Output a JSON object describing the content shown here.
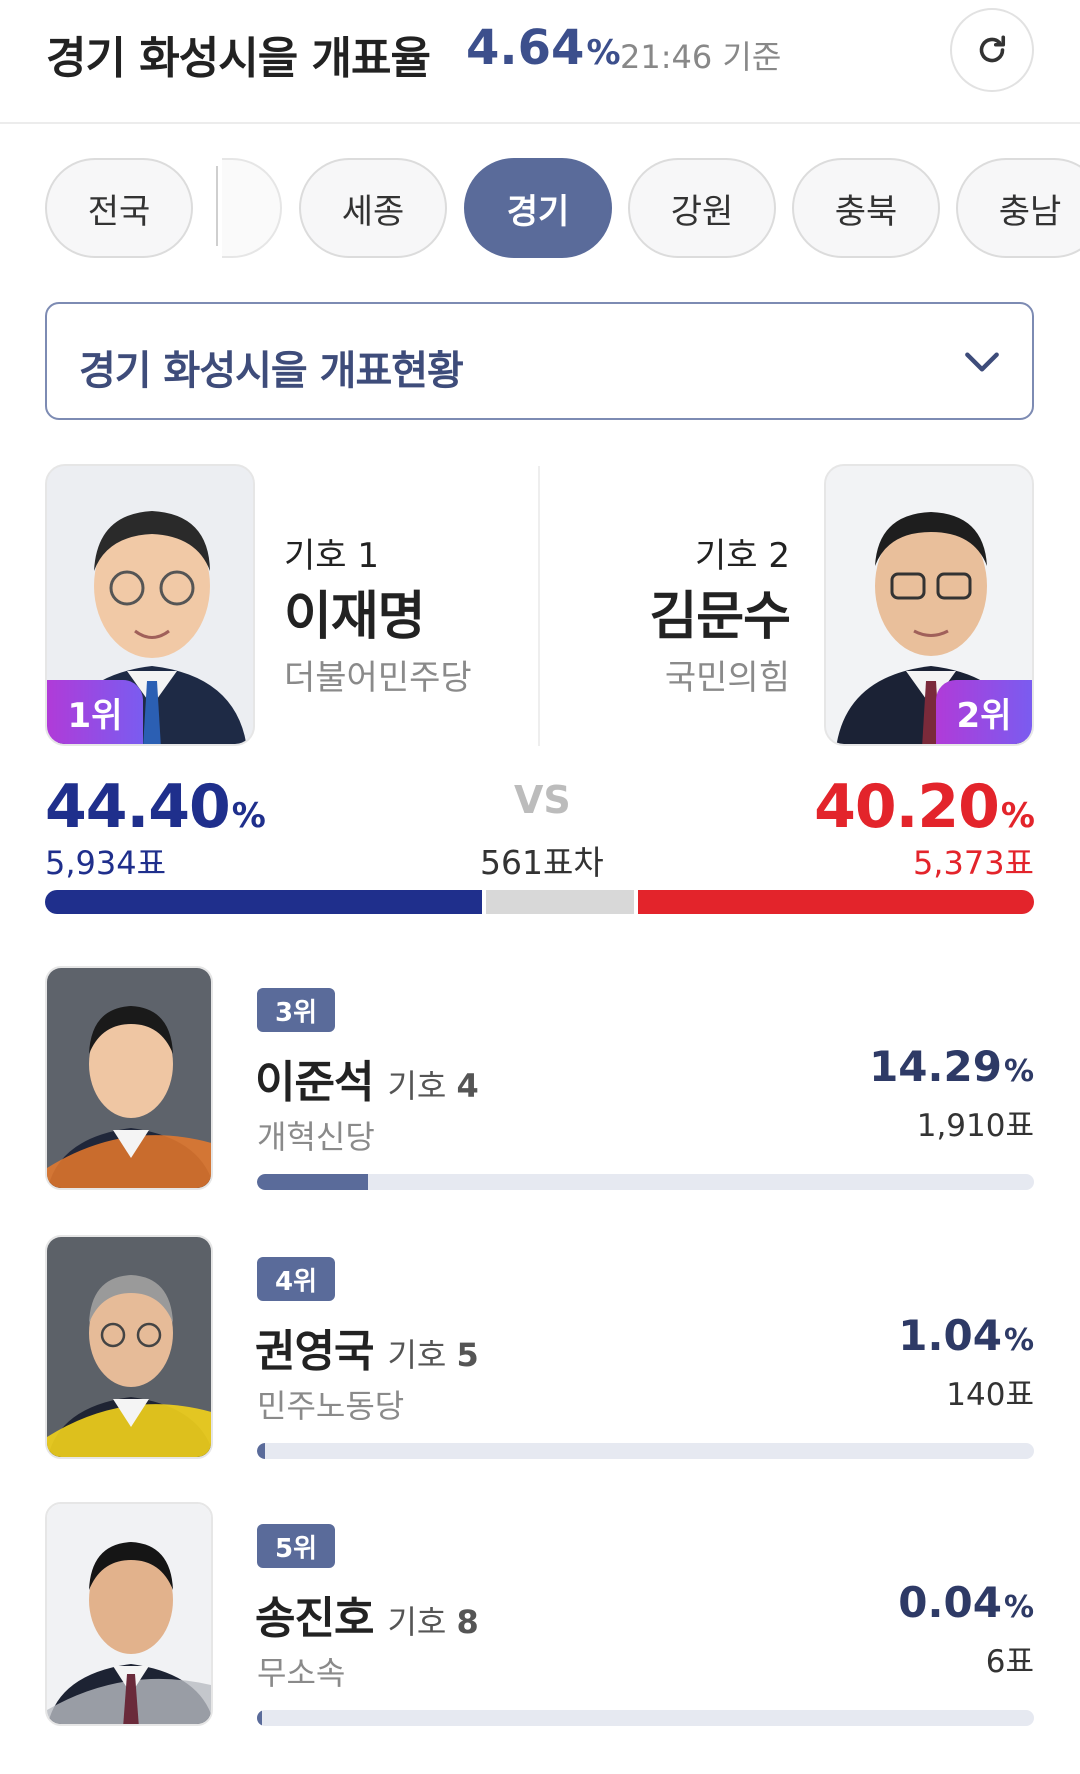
{
  "header": {
    "title": "경기 화성시을 개표율",
    "rate": "4.64",
    "rate_unit": "%",
    "time": "21:46 기준",
    "refresh_icon": "refresh-icon"
  },
  "tabs": [
    {
      "label": "전국",
      "active": false
    },
    {
      "label": "세종",
      "active": false
    },
    {
      "label": "경기",
      "active": true
    },
    {
      "label": "강원",
      "active": false
    },
    {
      "label": "충북",
      "active": false
    },
    {
      "label": "충남",
      "active": false
    }
  ],
  "dropdown": {
    "label": "경기 화성시을 개표현황",
    "icon": "chevron-down-icon"
  },
  "leaders": {
    "c1": {
      "number_label": "기호 1",
      "name": "이재명",
      "party": "더불어민주당",
      "rank": "1위",
      "pct": "44.40",
      "pct_unit": "%",
      "votes": "5,934표",
      "color": "#1f2f8c"
    },
    "c2": {
      "number_label": "기호 2",
      "name": "김문수",
      "party": "국민의힘",
      "rank": "2위",
      "pct": "40.20",
      "pct_unit": "%",
      "votes": "5,373표",
      "color": "#e3242b"
    },
    "vs": "VS",
    "diff": "561표차",
    "gap_color": "#d8d8d8",
    "bar_share": {
      "c1": 44.4,
      "gap": 15.4,
      "c2": 40.2
    }
  },
  "others": [
    {
      "rank": "3위",
      "name": "이준석",
      "number_prefix": "기호",
      "number": "4",
      "party": "개혁신당",
      "pct": "14.29",
      "pct_unit": "%",
      "votes": "1,910표",
      "share": 14.29
    },
    {
      "rank": "4위",
      "name": "권영국",
      "number_prefix": "기호",
      "number": "5",
      "party": "민주노동당",
      "pct": "1.04",
      "pct_unit": "%",
      "votes": "140표",
      "share": 1.04
    },
    {
      "rank": "5위",
      "name": "송진호",
      "number_prefix": "기호",
      "number": "8",
      "party": "무소속",
      "pct": "0.04",
      "pct_unit": "%",
      "votes": "6표",
      "share": 0.04
    }
  ],
  "colors": {
    "accent": "#5a6b9a",
    "header_rate": "#3c4f8c",
    "rank_badge": "#8a4fe6"
  }
}
